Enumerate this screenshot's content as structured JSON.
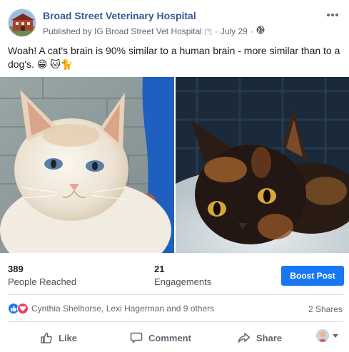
{
  "post": {
    "page_name": "Broad Street Veterinary Hospital",
    "published_by": "Published by IG Broad Street Vet Hospital",
    "help_mark": "[?]",
    "separator": "·",
    "date": "July 29",
    "separator2": "·",
    "audience_icon": "globe-icon",
    "menu_icon": "more-options-icon",
    "text": "Woah! A cat's brain is 90% similar to a human brain - more similar than to a dog's. 😁 🐱🐈"
  },
  "photos": [
    {
      "name": "white-cat-photo",
      "icon": "cat-photo"
    },
    {
      "name": "tortoiseshell-cat-photo",
      "icon": "cat-photo"
    }
  ],
  "insights": {
    "reached_count": "389",
    "reached_label": "People Reached",
    "engagements_count": "21",
    "engagements_label": "Engagements",
    "boost_label": "Boost Post"
  },
  "reactions": {
    "names": "Cynthia Shelhorse, Lexi Hagerman and 9 others",
    "shares": "2 Shares"
  },
  "actions": {
    "like": "Like",
    "comment": "Comment",
    "share": "Share"
  },
  "colors": {
    "link": "#385898",
    "primary": "#1877f2",
    "love": "#f33e58",
    "secondary_text": "#606770"
  }
}
